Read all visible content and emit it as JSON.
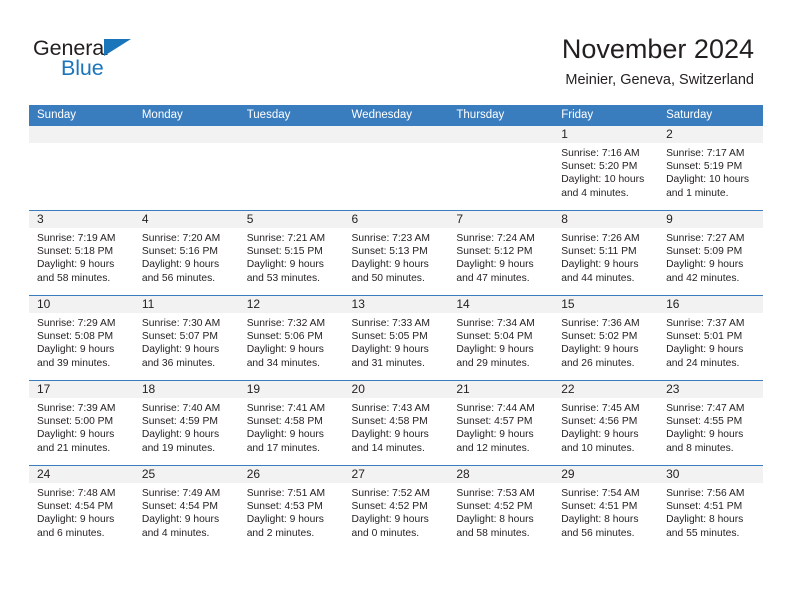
{
  "brand": {
    "name_part1": "General",
    "name_part2": "Blue",
    "accent_color": "#1b75bb"
  },
  "header": {
    "title": "November 2024",
    "location": "Meinier, Geneva, Switzerland"
  },
  "theme": {
    "header_row_color": "#3a7dbf",
    "daynum_band_color": "#f2f2f2",
    "text_color": "#231f20"
  },
  "weekdays": [
    "Sunday",
    "Monday",
    "Tuesday",
    "Wednesday",
    "Thursday",
    "Friday",
    "Saturday"
  ],
  "weeks": [
    [
      {
        "day": "",
        "sunrise": "",
        "sunset": "",
        "daylight1": "",
        "daylight2": ""
      },
      {
        "day": "",
        "sunrise": "",
        "sunset": "",
        "daylight1": "",
        "daylight2": ""
      },
      {
        "day": "",
        "sunrise": "",
        "sunset": "",
        "daylight1": "",
        "daylight2": ""
      },
      {
        "day": "",
        "sunrise": "",
        "sunset": "",
        "daylight1": "",
        "daylight2": ""
      },
      {
        "day": "",
        "sunrise": "",
        "sunset": "",
        "daylight1": "",
        "daylight2": ""
      },
      {
        "day": "1",
        "sunrise": "Sunrise: 7:16 AM",
        "sunset": "Sunset: 5:20 PM",
        "daylight1": "Daylight: 10 hours",
        "daylight2": "and 4 minutes."
      },
      {
        "day": "2",
        "sunrise": "Sunrise: 7:17 AM",
        "sunset": "Sunset: 5:19 PM",
        "daylight1": "Daylight: 10 hours",
        "daylight2": "and 1 minute."
      }
    ],
    [
      {
        "day": "3",
        "sunrise": "Sunrise: 7:19 AM",
        "sunset": "Sunset: 5:18 PM",
        "daylight1": "Daylight: 9 hours",
        "daylight2": "and 58 minutes."
      },
      {
        "day": "4",
        "sunrise": "Sunrise: 7:20 AM",
        "sunset": "Sunset: 5:16 PM",
        "daylight1": "Daylight: 9 hours",
        "daylight2": "and 56 minutes."
      },
      {
        "day": "5",
        "sunrise": "Sunrise: 7:21 AM",
        "sunset": "Sunset: 5:15 PM",
        "daylight1": "Daylight: 9 hours",
        "daylight2": "and 53 minutes."
      },
      {
        "day": "6",
        "sunrise": "Sunrise: 7:23 AM",
        "sunset": "Sunset: 5:13 PM",
        "daylight1": "Daylight: 9 hours",
        "daylight2": "and 50 minutes."
      },
      {
        "day": "7",
        "sunrise": "Sunrise: 7:24 AM",
        "sunset": "Sunset: 5:12 PM",
        "daylight1": "Daylight: 9 hours",
        "daylight2": "and 47 minutes."
      },
      {
        "day": "8",
        "sunrise": "Sunrise: 7:26 AM",
        "sunset": "Sunset: 5:11 PM",
        "daylight1": "Daylight: 9 hours",
        "daylight2": "and 44 minutes."
      },
      {
        "day": "9",
        "sunrise": "Sunrise: 7:27 AM",
        "sunset": "Sunset: 5:09 PM",
        "daylight1": "Daylight: 9 hours",
        "daylight2": "and 42 minutes."
      }
    ],
    [
      {
        "day": "10",
        "sunrise": "Sunrise: 7:29 AM",
        "sunset": "Sunset: 5:08 PM",
        "daylight1": "Daylight: 9 hours",
        "daylight2": "and 39 minutes."
      },
      {
        "day": "11",
        "sunrise": "Sunrise: 7:30 AM",
        "sunset": "Sunset: 5:07 PM",
        "daylight1": "Daylight: 9 hours",
        "daylight2": "and 36 minutes."
      },
      {
        "day": "12",
        "sunrise": "Sunrise: 7:32 AM",
        "sunset": "Sunset: 5:06 PM",
        "daylight1": "Daylight: 9 hours",
        "daylight2": "and 34 minutes."
      },
      {
        "day": "13",
        "sunrise": "Sunrise: 7:33 AM",
        "sunset": "Sunset: 5:05 PM",
        "daylight1": "Daylight: 9 hours",
        "daylight2": "and 31 minutes."
      },
      {
        "day": "14",
        "sunrise": "Sunrise: 7:34 AM",
        "sunset": "Sunset: 5:04 PM",
        "daylight1": "Daylight: 9 hours",
        "daylight2": "and 29 minutes."
      },
      {
        "day": "15",
        "sunrise": "Sunrise: 7:36 AM",
        "sunset": "Sunset: 5:02 PM",
        "daylight1": "Daylight: 9 hours",
        "daylight2": "and 26 minutes."
      },
      {
        "day": "16",
        "sunrise": "Sunrise: 7:37 AM",
        "sunset": "Sunset: 5:01 PM",
        "daylight1": "Daylight: 9 hours",
        "daylight2": "and 24 minutes."
      }
    ],
    [
      {
        "day": "17",
        "sunrise": "Sunrise: 7:39 AM",
        "sunset": "Sunset: 5:00 PM",
        "daylight1": "Daylight: 9 hours",
        "daylight2": "and 21 minutes."
      },
      {
        "day": "18",
        "sunrise": "Sunrise: 7:40 AM",
        "sunset": "Sunset: 4:59 PM",
        "daylight1": "Daylight: 9 hours",
        "daylight2": "and 19 minutes."
      },
      {
        "day": "19",
        "sunrise": "Sunrise: 7:41 AM",
        "sunset": "Sunset: 4:58 PM",
        "daylight1": "Daylight: 9 hours",
        "daylight2": "and 17 minutes."
      },
      {
        "day": "20",
        "sunrise": "Sunrise: 7:43 AM",
        "sunset": "Sunset: 4:58 PM",
        "daylight1": "Daylight: 9 hours",
        "daylight2": "and 14 minutes."
      },
      {
        "day": "21",
        "sunrise": "Sunrise: 7:44 AM",
        "sunset": "Sunset: 4:57 PM",
        "daylight1": "Daylight: 9 hours",
        "daylight2": "and 12 minutes."
      },
      {
        "day": "22",
        "sunrise": "Sunrise: 7:45 AM",
        "sunset": "Sunset: 4:56 PM",
        "daylight1": "Daylight: 9 hours",
        "daylight2": "and 10 minutes."
      },
      {
        "day": "23",
        "sunrise": "Sunrise: 7:47 AM",
        "sunset": "Sunset: 4:55 PM",
        "daylight1": "Daylight: 9 hours",
        "daylight2": "and 8 minutes."
      }
    ],
    [
      {
        "day": "24",
        "sunrise": "Sunrise: 7:48 AM",
        "sunset": "Sunset: 4:54 PM",
        "daylight1": "Daylight: 9 hours",
        "daylight2": "and 6 minutes."
      },
      {
        "day": "25",
        "sunrise": "Sunrise: 7:49 AM",
        "sunset": "Sunset: 4:54 PM",
        "daylight1": "Daylight: 9 hours",
        "daylight2": "and 4 minutes."
      },
      {
        "day": "26",
        "sunrise": "Sunrise: 7:51 AM",
        "sunset": "Sunset: 4:53 PM",
        "daylight1": "Daylight: 9 hours",
        "daylight2": "and 2 minutes."
      },
      {
        "day": "27",
        "sunrise": "Sunrise: 7:52 AM",
        "sunset": "Sunset: 4:52 PM",
        "daylight1": "Daylight: 9 hours",
        "daylight2": "and 0 minutes."
      },
      {
        "day": "28",
        "sunrise": "Sunrise: 7:53 AM",
        "sunset": "Sunset: 4:52 PM",
        "daylight1": "Daylight: 8 hours",
        "daylight2": "and 58 minutes."
      },
      {
        "day": "29",
        "sunrise": "Sunrise: 7:54 AM",
        "sunset": "Sunset: 4:51 PM",
        "daylight1": "Daylight: 8 hours",
        "daylight2": "and 56 minutes."
      },
      {
        "day": "30",
        "sunrise": "Sunrise: 7:56 AM",
        "sunset": "Sunset: 4:51 PM",
        "daylight1": "Daylight: 8 hours",
        "daylight2": "and 55 minutes."
      }
    ]
  ]
}
